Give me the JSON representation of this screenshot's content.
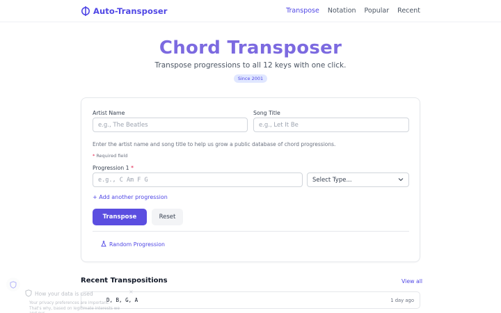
{
  "header": {
    "brand": "Auto-Transposer",
    "nav": [
      "Transpose",
      "Notation",
      "Popular",
      "Recent"
    ],
    "active_nav": "Transpose"
  },
  "hero": {
    "title": "Chord Transposer",
    "subtitle": "Transpose progressions to all 12 keys with one click.",
    "badge": "Since 2001"
  },
  "form": {
    "artist_label": "Artist Name",
    "artist_placeholder": "e.g., The Beatles",
    "song_label": "Song Title",
    "song_placeholder": "e.g., Let It Be",
    "help_text": "Enter the artist name and song title to help us grow a public database of chord progressions.",
    "required_star": "*",
    "required_note": "Required field",
    "progression_label": "Progression 1",
    "progression_placeholder": "e.g., C Am F G",
    "type_select": "Select Type...",
    "add_progression": "+ Add another progression",
    "transpose_button": "Transpose",
    "reset_button": "Reset",
    "random_progression": "Random Progression"
  },
  "recent": {
    "title": "Recent Transpositions",
    "view_all": "View all",
    "items": [
      {
        "chords": "D, B, G, A",
        "time": "1 day ago"
      }
    ]
  },
  "privacy": {
    "title": "How your data is used",
    "text": "Your privacy preferences are important. That's why, based on legitimate interests we and our",
    "close": "×"
  },
  "colors": {
    "accent": "#4f46e5",
    "title": "#7c6ae0",
    "button": "#5b4ee0"
  },
  "icons": [
    "note-icon",
    "flask-icon",
    "shield-icon",
    "chevron-down-icon",
    "close-icon"
  ]
}
